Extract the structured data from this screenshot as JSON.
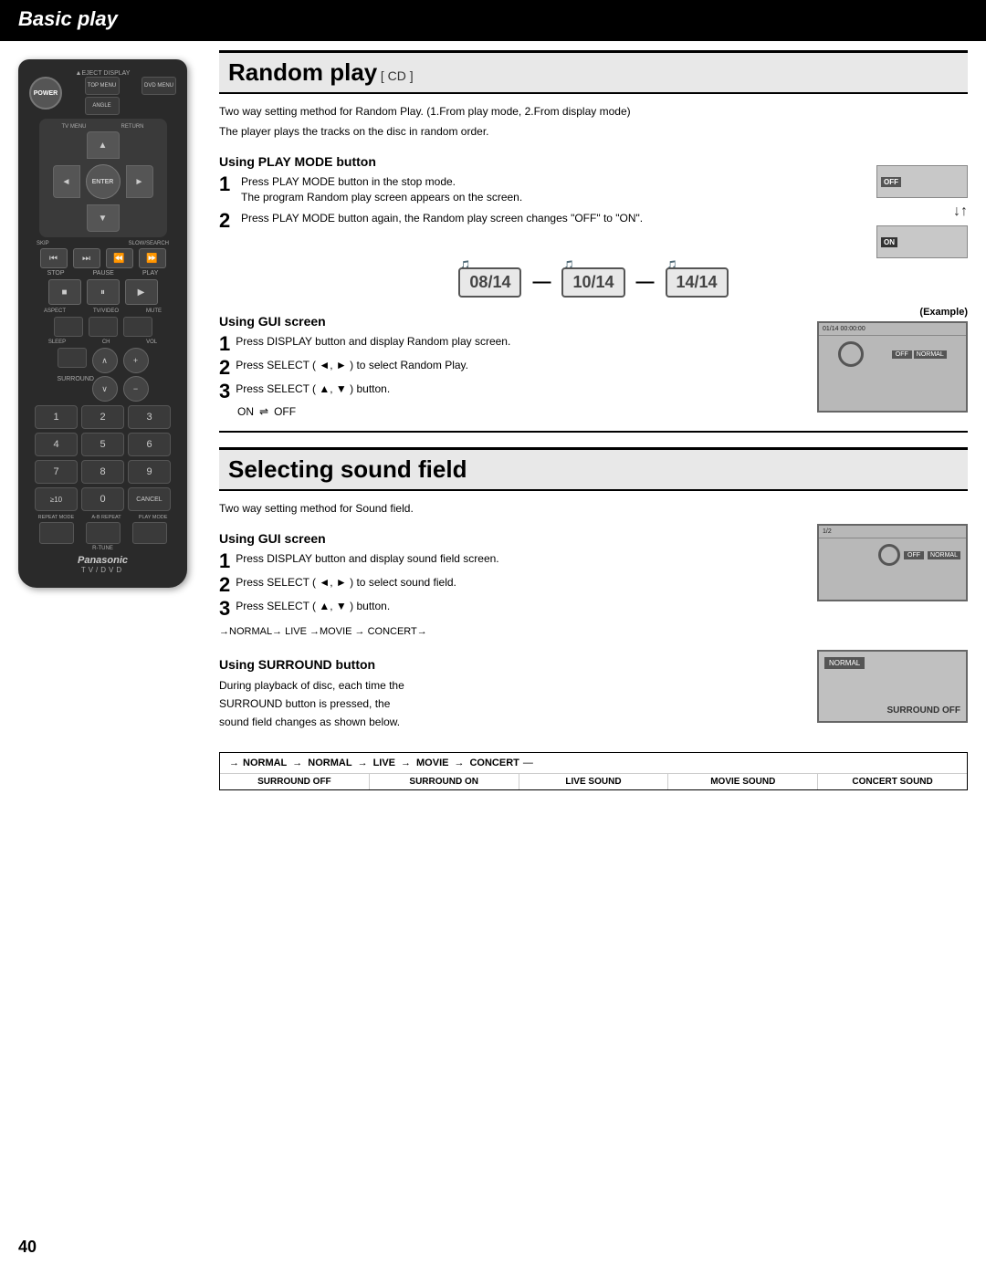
{
  "header": {
    "title": "Basic play",
    "page_number": "40"
  },
  "random_play_section": {
    "title": "Random play",
    "cd_tag": "[ CD ]",
    "intro": "Two way setting method for Random Play. (1.From play mode, 2.From display mode)",
    "intro2": "The player plays the tracks on the disc in random order.",
    "play_mode": {
      "heading": "Using PLAY MODE button",
      "step1": "Press PLAY MODE button in the stop mode.",
      "step1b": "The program Random play screen appears on the screen.",
      "step2": "Press PLAY MODE button again, the Random play screen changes \"OFF\" to \"ON\"."
    },
    "tracks": {
      "track1": "08/14",
      "track2": "10/14",
      "track3": "14/14"
    },
    "gui_screen": {
      "heading": "Using GUI screen",
      "example_label": "Example",
      "step1": "Press DISPLAY button and display Random play screen.",
      "step2": "Press SELECT ( ◄, ► ) to select Random Play.",
      "step3": "Press SELECT ( ▲, ▼ ) button.",
      "flow_on": "ON",
      "flow_off": "OFF"
    }
  },
  "sound_field_section": {
    "title": "Selecting sound field",
    "intro": "Two way setting method for Sound field.",
    "gui_screen": {
      "heading": "Using GUI screen",
      "step1": "Press DISPLAY button and display sound field screen.",
      "step2": "Press SELECT ( ◄, ► ) to select sound field.",
      "step3": "Press SELECT ( ▲, ▼ ) button.",
      "flow": "→NORMAL→ LIVE →MOVIE → CONCERT→"
    },
    "surround": {
      "heading": "Using SURROUND button",
      "desc1": "During playback of disc, each time the",
      "desc2": "SURROUND button is pressed, the",
      "desc3": "sound field changes as shown below.",
      "screen_label": "SURROUND OFF"
    },
    "flow_table": {
      "arrows": [
        "NORMAL",
        "NORMAL",
        "LIVE",
        "MOVIE",
        "CONCERT"
      ],
      "labels": [
        "SURROUND OFF",
        "SURROUND ON",
        "LIVE SOUND",
        "MOVIE SOUND",
        "CONCERT SOUND"
      ]
    }
  },
  "remote": {
    "power_label": "POWER",
    "eject_display": "▲EJECT  DISPLAY",
    "top_menu": "TOP MENU",
    "angle": "ANGLE",
    "dvd_menu": "DVD MENU",
    "tv_menu": "TV MENU",
    "enter": "ENTER",
    "return": "RETURN",
    "skip_label": "SKIP",
    "slow_search": "SLOW/SEARCH",
    "stop": "STOP",
    "pause": "PAUSE",
    "play": "PLAY",
    "aspect": "ASPECT",
    "tv_video": "TV/VIDEO",
    "mute": "MUTE",
    "sleep": "SLEEP",
    "ch": "CH",
    "vol": "VOL",
    "surround": "SURROUND",
    "nums": [
      "1",
      "2",
      "3",
      "4",
      "5",
      "6",
      "7",
      "8",
      "9",
      "≥10",
      "0",
      "CANCEL"
    ],
    "repeat_mode": "REPEAT MODE",
    "ab_repeat": "A-B REPEAT",
    "play_mode": "PLAY MODE",
    "r_tune": "R-TUNE",
    "brand": "Panasonic",
    "tv_dvd": "TV/DVD"
  }
}
